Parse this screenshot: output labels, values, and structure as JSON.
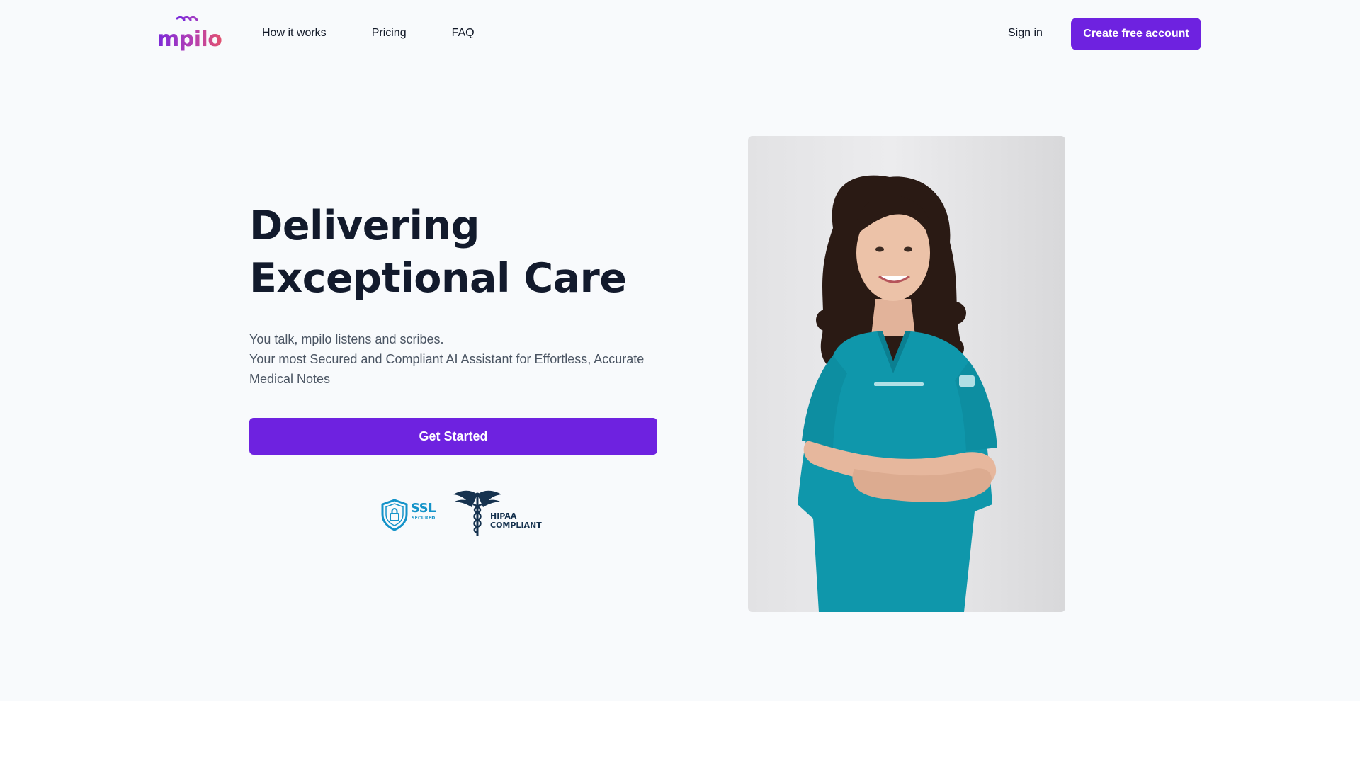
{
  "brand": {
    "name": "mpilo",
    "colors": {
      "primary": "#6e22e0",
      "heading": "#121a2c",
      "body": "#4b5563",
      "hero_bg": "#f8fafc"
    }
  },
  "header": {
    "nav": [
      {
        "label": "How it works"
      },
      {
        "label": "Pricing"
      },
      {
        "label": "FAQ"
      }
    ],
    "sign_in": "Sign in",
    "create_account": "Create free account"
  },
  "hero": {
    "title_lines": [
      "Delivering",
      "Exceptional Care"
    ],
    "subtitle_lines": [
      "You talk, mpilo listens and scribes.",
      "Your most Secured and Compliant AI Assistant for Effortless, Accurate",
      "Medical Notes"
    ],
    "cta": "Get Started",
    "badges": {
      "ssl": {
        "title": "SSL",
        "subtitle": "SECURED",
        "icon": "shield-lock-icon"
      },
      "hipaa": {
        "line1": "HIPAA",
        "line2": "COMPLIANT",
        "icon": "caduceus-icon"
      }
    },
    "photo": {
      "icon": "doctor-portrait"
    }
  }
}
